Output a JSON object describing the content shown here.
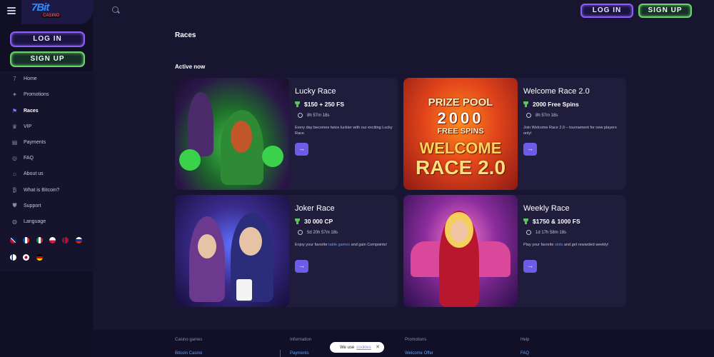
{
  "header": {
    "login": "LOG IN",
    "signup": "SIGN UP",
    "search_icon": "search-icon"
  },
  "logo": {
    "main": "7Bit",
    "sub": "CASINO"
  },
  "sidebar": {
    "login": "LOG IN",
    "signup": "SIGN UP",
    "items": [
      {
        "label": "Home",
        "icon": "seven-icon"
      },
      {
        "label": "Promotions",
        "icon": "gift-icon"
      },
      {
        "label": "Races",
        "icon": "flag-icon",
        "active": true
      },
      {
        "label": "VIP",
        "icon": "crown-icon"
      },
      {
        "label": "Payments",
        "icon": "wallet-icon"
      },
      {
        "label": "FAQ",
        "icon": "lifebuoy-icon"
      },
      {
        "label": "About us",
        "icon": "house-icon"
      },
      {
        "label": "What is Bitcoin?",
        "icon": "bitcoin-icon"
      },
      {
        "label": "Support",
        "icon": "shield-icon"
      },
      {
        "label": "Language",
        "icon": "globe-icon"
      }
    ],
    "flags": [
      "uk",
      "fr",
      "it",
      "pl",
      "no",
      "ru",
      "fi",
      "jp",
      "de"
    ]
  },
  "main": {
    "title": "Races",
    "section": "Active now",
    "races": [
      {
        "name": "Lucky Race",
        "prize": "$150 + 250 FS",
        "timer": "8h 57m 18s",
        "desc": "Every day becomes twice luckier with our exciting Lucky Race.",
        "link": "",
        "desc_after": "",
        "go": "→"
      },
      {
        "name": "Welcome Race 2.0",
        "prize": "2000 Free Spins",
        "timer": "8h 57m 18s",
        "desc": "Join Welcome Race 2.0 – tournament for new players only!",
        "link": "",
        "desc_after": "",
        "go": "→",
        "art_text": [
          "PRIZE POOL",
          "2000",
          "FREE SPINS",
          "WELCOME",
          "RACE 2.0"
        ]
      },
      {
        "name": "Joker Race",
        "prize": "30 000 CP",
        "timer": "5d 20h 57m 18s",
        "desc": "Enjoy your favorite ",
        "link": "table games",
        "desc_after": " and gain Compoints!",
        "go": "→"
      },
      {
        "name": "Weekly Race",
        "prize": "$1750 & 1000 FS",
        "timer": "1d 17h 58m 18s",
        "desc": "Play your favorite ",
        "link": "slots",
        "desc_after": " and get rewarded weekly!",
        "go": "→"
      }
    ]
  },
  "footer": {
    "columns": [
      {
        "title": "Casino games",
        "link": "Bitcoin Casino"
      },
      {
        "title": "Information",
        "link": "Payments"
      },
      {
        "title": "Promotions",
        "link": "Welcome Offer"
      },
      {
        "title": "Help",
        "link": "FAQ"
      }
    ]
  },
  "cookie": {
    "text": "We use",
    "link": "cookies",
    "close": "✕"
  },
  "colors": {
    "accent": "#6c5ce7",
    "login_border": "#8b5cf6",
    "signup_border": "#6bd26b",
    "prize_icon": "#56c956"
  }
}
